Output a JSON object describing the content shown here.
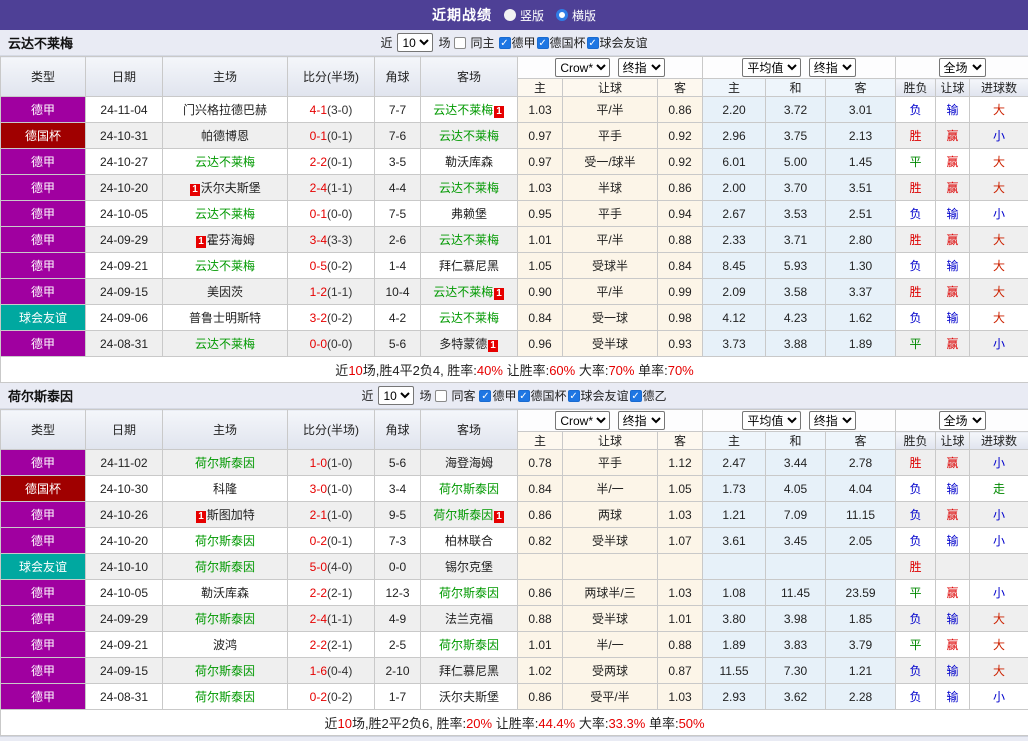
{
  "topbar": {
    "title": "近期战绩",
    "radios": [
      {
        "label": "竖版",
        "checked": false
      },
      {
        "label": "横版",
        "checked": true
      }
    ]
  },
  "colors": {
    "topbar_bg": "#4e4096",
    "league_de": "#a000a0",
    "league_cup": "#a00000",
    "league_friendly": "#00a8a0",
    "self_team": "#009900",
    "score": "#e60000",
    "odds_col_bg": "#fcf5e8",
    "avg_col_bg": "#e7f1f9"
  },
  "result_colors": {
    "胜": "#dd0000",
    "平": "#008800",
    "负": "#0000cc",
    "赢": "#dd0000",
    "输": "#0000cc",
    "走": "#008800",
    "大": "#cc2200",
    "小": "#0000cc"
  },
  "table_headers": {
    "left": [
      "类型",
      "日期",
      "主场",
      "比分(半场)",
      "角球",
      "客场"
    ],
    "right": [
      "主",
      "让球",
      "客",
      "主",
      "和",
      "客",
      "胜负",
      "让球",
      "进球数"
    ]
  },
  "sections": [
    {
      "team": "云达不莱梅",
      "filter": {
        "prefix": "近",
        "count": "10",
        "suffix": "场",
        "same": {
          "label": "同主",
          "checked": false
        },
        "leagues": [
          {
            "label": "德甲",
            "checked": true
          },
          {
            "label": "德国杯",
            "checked": true
          },
          {
            "label": "球会友谊",
            "checked": true
          }
        ]
      },
      "selects": {
        "odds": "Crow*",
        "odds_ref": "终指",
        "avg": "平均值",
        "avg_ref": "终指",
        "scope": "全场"
      },
      "rows": [
        {
          "league": "德甲",
          "league_type": "de",
          "date": "24-11-04",
          "home": "门兴格拉德巴赫",
          "home_self": false,
          "home_rc": false,
          "score": "4-1",
          "ht": "(3-0)",
          "corners": "7-7",
          "away": "云达不莱梅",
          "away_self": true,
          "away_rc": true,
          "odds": [
            "1.03",
            "平/半",
            "0.86"
          ],
          "avg": [
            "2.20",
            "3.72",
            "3.01"
          ],
          "res": [
            "负",
            "输",
            "大"
          ]
        },
        {
          "league": "德国杯",
          "league_type": "cup",
          "date": "24-10-31",
          "home": "帕德博恩",
          "home_self": false,
          "home_rc": false,
          "score": "0-1",
          "ht": "(0-1)",
          "corners": "7-6",
          "away": "云达不莱梅",
          "away_self": true,
          "away_rc": false,
          "odds": [
            "0.97",
            "平手",
            "0.92"
          ],
          "avg": [
            "2.96",
            "3.75",
            "2.13"
          ],
          "res": [
            "胜",
            "赢",
            "小"
          ]
        },
        {
          "league": "德甲",
          "league_type": "de",
          "date": "24-10-27",
          "home": "云达不莱梅",
          "home_self": true,
          "home_rc": false,
          "score": "2-2",
          "ht": "(0-1)",
          "corners": "3-5",
          "away": "勒沃库森",
          "away_self": false,
          "away_rc": false,
          "odds": [
            "0.97",
            "受一/球半",
            "0.92"
          ],
          "avg": [
            "6.01",
            "5.00",
            "1.45"
          ],
          "res": [
            "平",
            "赢",
            "大"
          ]
        },
        {
          "league": "德甲",
          "league_type": "de",
          "date": "24-10-20",
          "home": "沃尔夫斯堡",
          "home_self": false,
          "home_rc": true,
          "score": "2-4",
          "ht": "(1-1)",
          "corners": "4-4",
          "away": "云达不莱梅",
          "away_self": true,
          "away_rc": false,
          "odds": [
            "1.03",
            "半球",
            "0.86"
          ],
          "avg": [
            "2.00",
            "3.70",
            "3.51"
          ],
          "res": [
            "胜",
            "赢",
            "大"
          ]
        },
        {
          "league": "德甲",
          "league_type": "de",
          "date": "24-10-05",
          "home": "云达不莱梅",
          "home_self": true,
          "home_rc": false,
          "score": "0-1",
          "ht": "(0-0)",
          "corners": "7-5",
          "away": "弗赖堡",
          "away_self": false,
          "away_rc": false,
          "odds": [
            "0.95",
            "平手",
            "0.94"
          ],
          "avg": [
            "2.67",
            "3.53",
            "2.51"
          ],
          "res": [
            "负",
            "输",
            "小"
          ]
        },
        {
          "league": "德甲",
          "league_type": "de",
          "date": "24-09-29",
          "home": "霍芬海姆",
          "home_self": false,
          "home_rc": true,
          "score": "3-4",
          "ht": "(3-3)",
          "corners": "2-6",
          "away": "云达不莱梅",
          "away_self": true,
          "away_rc": false,
          "odds": [
            "1.01",
            "平/半",
            "0.88"
          ],
          "avg": [
            "2.33",
            "3.71",
            "2.80"
          ],
          "res": [
            "胜",
            "赢",
            "大"
          ]
        },
        {
          "league": "德甲",
          "league_type": "de",
          "date": "24-09-21",
          "home": "云达不莱梅",
          "home_self": true,
          "home_rc": false,
          "score": "0-5",
          "ht": "(0-2)",
          "corners": "1-4",
          "away": "拜仁慕尼黑",
          "away_self": false,
          "away_rc": false,
          "odds": [
            "1.05",
            "受球半",
            "0.84"
          ],
          "avg": [
            "8.45",
            "5.93",
            "1.30"
          ],
          "res": [
            "负",
            "输",
            "大"
          ]
        },
        {
          "league": "德甲",
          "league_type": "de",
          "date": "24-09-15",
          "home": "美因茨",
          "home_self": false,
          "home_rc": false,
          "score": "1-2",
          "ht": "(1-1)",
          "corners": "10-4",
          "away": "云达不莱梅",
          "away_self": true,
          "away_rc": true,
          "odds": [
            "0.90",
            "平/半",
            "0.99"
          ],
          "avg": [
            "2.09",
            "3.58",
            "3.37"
          ],
          "res": [
            "胜",
            "赢",
            "大"
          ]
        },
        {
          "league": "球会友谊",
          "league_type": "fr",
          "date": "24-09-06",
          "home": "普鲁士明斯特",
          "home_self": false,
          "home_rc": false,
          "score": "3-2",
          "ht": "(0-2)",
          "corners": "4-2",
          "away": "云达不莱梅",
          "away_self": true,
          "away_rc": false,
          "odds": [
            "0.84",
            "受一球",
            "0.98"
          ],
          "avg": [
            "4.12",
            "4.23",
            "1.62"
          ],
          "res": [
            "负",
            "输",
            "大"
          ]
        },
        {
          "league": "德甲",
          "league_type": "de",
          "date": "24-08-31",
          "home": "云达不莱梅",
          "home_self": true,
          "home_rc": false,
          "score": "0-0",
          "ht": "(0-0)",
          "corners": "5-6",
          "away": "多特蒙德",
          "away_self": false,
          "away_rc": true,
          "odds": [
            "0.96",
            "受半球",
            "0.93"
          ],
          "avg": [
            "3.73",
            "3.88",
            "1.89"
          ],
          "res": [
            "平",
            "赢",
            "小"
          ]
        }
      ],
      "summary": [
        [
          "近",
          "k"
        ],
        [
          "10",
          "r"
        ],
        [
          "场,胜4平2负4, 胜率:",
          "k"
        ],
        [
          "40%",
          "r"
        ],
        [
          " 让胜率:",
          "k"
        ],
        [
          "60%",
          "r"
        ],
        [
          " 大率:",
          "k"
        ],
        [
          "70%",
          "r"
        ],
        [
          " 单率:",
          "k"
        ],
        [
          "70%",
          "r"
        ]
      ]
    },
    {
      "team": "荷尔斯泰因",
      "filter": {
        "prefix": "近",
        "count": "10",
        "suffix": "场",
        "same": {
          "label": "同客",
          "checked": false
        },
        "leagues": [
          {
            "label": "德甲",
            "checked": true
          },
          {
            "label": "德国杯",
            "checked": true
          },
          {
            "label": "球会友谊",
            "checked": true
          },
          {
            "label": "德乙",
            "checked": true
          }
        ]
      },
      "selects": {
        "odds": "Crow*",
        "odds_ref": "终指",
        "avg": "平均值",
        "avg_ref": "终指",
        "scope": "全场"
      },
      "rows": [
        {
          "league": "德甲",
          "league_type": "de",
          "date": "24-11-02",
          "home": "荷尔斯泰因",
          "home_self": true,
          "home_rc": false,
          "score": "1-0",
          "ht": "(1-0)",
          "corners": "5-6",
          "away": "海登海姆",
          "away_self": false,
          "away_rc": false,
          "odds": [
            "0.78",
            "平手",
            "1.12"
          ],
          "avg": [
            "2.47",
            "3.44",
            "2.78"
          ],
          "res": [
            "胜",
            "赢",
            "小"
          ]
        },
        {
          "league": "德国杯",
          "league_type": "cup",
          "date": "24-10-30",
          "home": "科隆",
          "home_self": false,
          "home_rc": false,
          "score": "3-0",
          "ht": "(1-0)",
          "corners": "3-4",
          "away": "荷尔斯泰因",
          "away_self": true,
          "away_rc": false,
          "odds": [
            "0.84",
            "半/一",
            "1.05"
          ],
          "avg": [
            "1.73",
            "4.05",
            "4.04"
          ],
          "res": [
            "负",
            "输",
            "走"
          ]
        },
        {
          "league": "德甲",
          "league_type": "de",
          "date": "24-10-26",
          "home": "斯图加特",
          "home_self": false,
          "home_rc": true,
          "score": "2-1",
          "ht": "(1-0)",
          "corners": "9-5",
          "away": "荷尔斯泰因",
          "away_self": true,
          "away_rc": true,
          "odds": [
            "0.86",
            "两球",
            "1.03"
          ],
          "avg": [
            "1.21",
            "7.09",
            "11.15"
          ],
          "res": [
            "负",
            "赢",
            "小"
          ]
        },
        {
          "league": "德甲",
          "league_type": "de",
          "date": "24-10-20",
          "home": "荷尔斯泰因",
          "home_self": true,
          "home_rc": false,
          "score": "0-2",
          "ht": "(0-1)",
          "corners": "7-3",
          "away": "柏林联合",
          "away_self": false,
          "away_rc": false,
          "odds": [
            "0.82",
            "受半球",
            "1.07"
          ],
          "avg": [
            "3.61",
            "3.45",
            "2.05"
          ],
          "res": [
            "负",
            "输",
            "小"
          ]
        },
        {
          "league": "球会友谊",
          "league_type": "fr",
          "date": "24-10-10",
          "home": "荷尔斯泰因",
          "home_self": true,
          "home_rc": false,
          "score": "5-0",
          "ht": "(4-0)",
          "corners": "0-0",
          "away": "锡尔克堡",
          "away_self": false,
          "away_rc": false,
          "odds": [
            "",
            "",
            ""
          ],
          "avg": [
            "",
            "",
            ""
          ],
          "res": [
            "胜",
            "",
            ""
          ]
        },
        {
          "league": "德甲",
          "league_type": "de",
          "date": "24-10-05",
          "home": "勒沃库森",
          "home_self": false,
          "home_rc": false,
          "score": "2-2",
          "ht": "(2-1)",
          "corners": "12-3",
          "away": "荷尔斯泰因",
          "away_self": true,
          "away_rc": false,
          "odds": [
            "0.86",
            "两球半/三",
            "1.03"
          ],
          "avg": [
            "1.08",
            "11.45",
            "23.59"
          ],
          "res": [
            "平",
            "赢",
            "小"
          ]
        },
        {
          "league": "德甲",
          "league_type": "de",
          "date": "24-09-29",
          "home": "荷尔斯泰因",
          "home_self": true,
          "home_rc": false,
          "score": "2-4",
          "ht": "(1-1)",
          "corners": "4-9",
          "away": "法兰克福",
          "away_self": false,
          "away_rc": false,
          "odds": [
            "0.88",
            "受半球",
            "1.01"
          ],
          "avg": [
            "3.80",
            "3.98",
            "1.85"
          ],
          "res": [
            "负",
            "输",
            "大"
          ]
        },
        {
          "league": "德甲",
          "league_type": "de",
          "date": "24-09-21",
          "home": "波鸿",
          "home_self": false,
          "home_rc": false,
          "score": "2-2",
          "ht": "(2-1)",
          "corners": "2-5",
          "away": "荷尔斯泰因",
          "away_self": true,
          "away_rc": false,
          "odds": [
            "1.01",
            "半/一",
            "0.88"
          ],
          "avg": [
            "1.89",
            "3.83",
            "3.79"
          ],
          "res": [
            "平",
            "赢",
            "大"
          ]
        },
        {
          "league": "德甲",
          "league_type": "de",
          "date": "24-09-15",
          "home": "荷尔斯泰因",
          "home_self": true,
          "home_rc": false,
          "score": "1-6",
          "ht": "(0-4)",
          "corners": "2-10",
          "away": "拜仁慕尼黑",
          "away_self": false,
          "away_rc": false,
          "odds": [
            "1.02",
            "受两球",
            "0.87"
          ],
          "avg": [
            "11.55",
            "7.30",
            "1.21"
          ],
          "res": [
            "负",
            "输",
            "大"
          ]
        },
        {
          "league": "德甲",
          "league_type": "de",
          "date": "24-08-31",
          "home": "荷尔斯泰因",
          "home_self": true,
          "home_rc": false,
          "score": "0-2",
          "ht": "(0-2)",
          "corners": "1-7",
          "away": "沃尔夫斯堡",
          "away_self": false,
          "away_rc": false,
          "odds": [
            "0.86",
            "受平/半",
            "1.03"
          ],
          "avg": [
            "2.93",
            "3.62",
            "2.28"
          ],
          "res": [
            "负",
            "输",
            "小"
          ]
        }
      ],
      "summary": [
        [
          "近",
          "k"
        ],
        [
          "10",
          "r"
        ],
        [
          "场,胜2平2负6, 胜率:",
          "k"
        ],
        [
          "20%",
          "r"
        ],
        [
          " 让胜率:",
          "k"
        ],
        [
          "44.4%",
          "r"
        ],
        [
          " 大率:",
          "k"
        ],
        [
          "33.3%",
          "r"
        ],
        [
          " 单率:",
          "k"
        ],
        [
          "50%",
          "r"
        ]
      ]
    }
  ]
}
